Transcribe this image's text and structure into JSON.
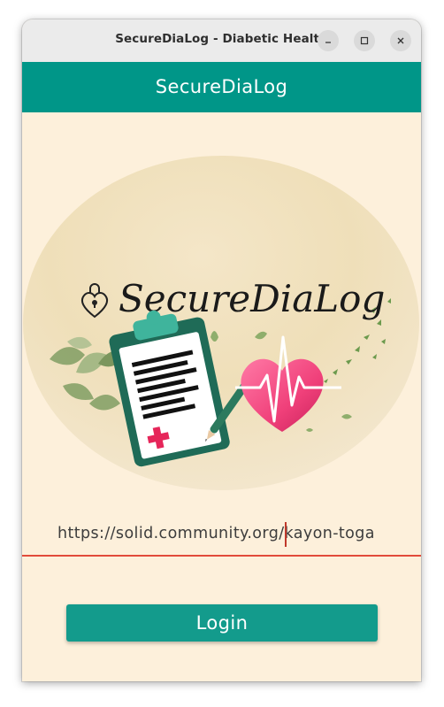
{
  "window": {
    "title": "SecureDiaLog - Diabetic Health",
    "controls": {
      "minimize_icon": "minimize-icon",
      "maximize_icon": "maximize-icon",
      "close_icon": "close-icon"
    }
  },
  "appbar": {
    "title": "SecureDiaLog",
    "color": "#009688"
  },
  "logo": {
    "text": "SecureDiaLog",
    "icons": [
      "heart-lock-icon",
      "clipboard-icon",
      "pen-icon",
      "heart-pulse-icon",
      "leaves"
    ]
  },
  "login_form": {
    "url_value": "https://solid.community.org/kayon-toga",
    "underline_color": "#e24b3b",
    "login_label": "Login",
    "button_color": "#139b8c"
  },
  "colors": {
    "background": "#fdf0db",
    "accent": "#009688",
    "heart": "#f0407a"
  }
}
